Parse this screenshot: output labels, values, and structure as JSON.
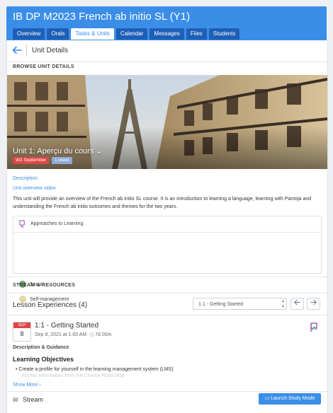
{
  "course": {
    "title": "IB DP M2023 French ab initio SL (Y1)"
  },
  "tabs": [
    {
      "label": "Overview",
      "active": false
    },
    {
      "label": "Orals",
      "active": false
    },
    {
      "label": "Tasks & Units",
      "active": true
    },
    {
      "label": "Calendar",
      "active": false
    },
    {
      "label": "Messages",
      "active": false
    },
    {
      "label": "Files",
      "active": false
    },
    {
      "label": "Students",
      "active": false
    }
  ],
  "header": {
    "back_icon": "arrow-left-icon",
    "title": "Unit Details"
  },
  "browse": {
    "section_label": "BROWSE UNIT DETAILS"
  },
  "unit": {
    "title": "Unit 1: Aperçu du cours ⌄",
    "week_badge": "W2 September",
    "duration_badge": "1 week",
    "description_label": "Description",
    "video_link": "Unit overview video",
    "description": "This unit will provide an overview of the French ab initio SL course. It is an introduction to learning a language, learning with Pamoja and understanding the French ab initio outcomes and themes for the two years."
  },
  "atl": {
    "title": "Approaches to Learning",
    "items": [
      {
        "label": "Social",
        "icon": "social-icon"
      },
      {
        "label": "Self-management",
        "icon": "self-management-icon"
      }
    ]
  },
  "stream_resources": {
    "section_label": "STREAM & RESOURCES",
    "lesson_title": "Lesson Experiences (4)",
    "select_value": "1:1 - Getting Started",
    "prev_icon": "arrow-left-icon",
    "next_icon": "arrow-right-icon"
  },
  "lesson": {
    "month": "SEP",
    "day": "8",
    "name": "1:1 - Getting Started",
    "date": "Sep 8, 2021 at 1:00 AM",
    "duration": "7d 00m",
    "guidance_label": "Description & Guidance",
    "objectives_head": "Learning Objectives",
    "objective_1": "Create a profile for yourself in the learning management system (LMS)",
    "objective_2": "Access information from the Course Road Map",
    "show_more": "Show More ›"
  },
  "stream": {
    "label": "Stream",
    "launch_button": "Launch Study Mode"
  },
  "colors": {
    "primary": "#3b8ee8",
    "tab_dark": "#1e5fb6",
    "badge_red": "#e04545",
    "badge_blue": "#8fa9d6"
  }
}
